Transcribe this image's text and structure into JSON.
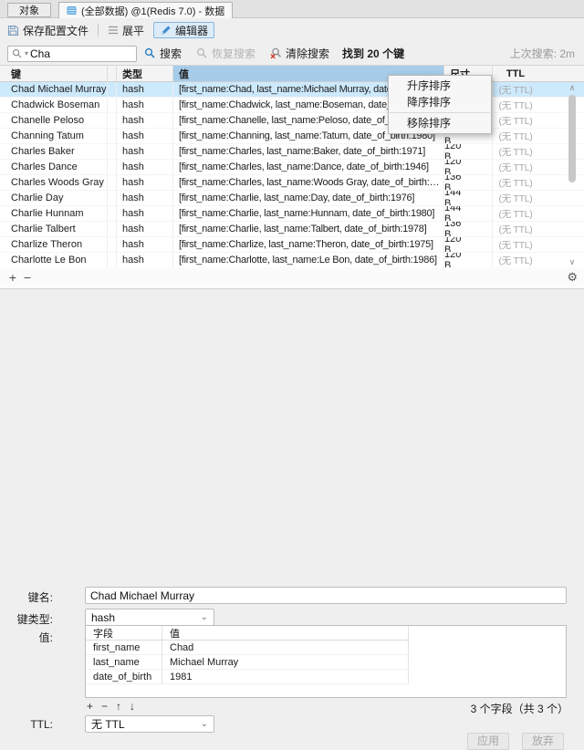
{
  "colors": {
    "accent": "#2e7fc2",
    "selection": "#cde9fc",
    "hdr-hi": "#a6cce9",
    "danger": "#d03b2f",
    "disabled": "#a6a6a6"
  },
  "glyphs": {
    "plus": "+",
    "minus": "−",
    "arrow_up": "↑",
    "arrow_down": "↓",
    "gear": "⚙",
    "chevron_down": "⌄",
    "scroll_up": "∧",
    "scroll_down": "∨"
  },
  "tabs": {
    "objects": "对象",
    "data": "(全部数据) @1(Redis 7.0) - 数据"
  },
  "toolbar": {
    "save": "保存配置文件",
    "flatten": "展平",
    "editor": "编辑器"
  },
  "search": {
    "query": "Cha",
    "search": "搜索",
    "restore": "恢复搜索",
    "clear": "清除搜索",
    "found": "找到 20 个键",
    "last": "上次搜索: 2m"
  },
  "table": {
    "headers": {
      "key": "键",
      "type": "类型",
      "value": "值",
      "size": "尺寸",
      "ttl": "TTL"
    },
    "rows": [
      {
        "key": "Chad Michael Murray",
        "type": "hash",
        "value": "[first_name:Chad, last_name:Michael Murray, date_o",
        "size": "",
        "ttl": "(无 TTL)",
        "selected": true
      },
      {
        "key": "Chadwick Boseman",
        "type": "hash",
        "value": "[first_name:Chadwick, last_name:Boseman, date_of_",
        "size": "",
        "ttl": "(无 TTL)",
        "selected": false
      },
      {
        "key": "Chanelle Peloso",
        "type": "hash",
        "value": "[first_name:Chanelle, last_name:Peloso, date_of_birt",
        "size": "",
        "ttl": "(无 TTL)",
        "selected": false
      },
      {
        "key": "Channing Tatum",
        "type": "hash",
        "value": "[first_name:Channing, last_name:Tatum, date_of_birth:1980]",
        "size": "120 B",
        "ttl": "(无 TTL)",
        "selected": false
      },
      {
        "key": "Charles Baker",
        "type": "hash",
        "value": "[first_name:Charles, last_name:Baker, date_of_birth:1971]",
        "size": "120 B",
        "ttl": "(无 TTL)",
        "selected": false
      },
      {
        "key": "Charles Dance",
        "type": "hash",
        "value": "[first_name:Charles, last_name:Dance, date_of_birth:1946]",
        "size": "120 B",
        "ttl": "(无 TTL)",
        "selected": false
      },
      {
        "key": "Charles Woods Gray",
        "type": "hash",
        "value": "[first_name:Charles, last_name:Woods Gray, date_of_birth:…",
        "size": "136 B",
        "ttl": "(无 TTL)",
        "selected": false
      },
      {
        "key": "Charlie Day",
        "type": "hash",
        "value": "[first_name:Charlie, last_name:Day, date_of_birth:1976]",
        "size": "144 B",
        "ttl": "(无 TTL)",
        "selected": false
      },
      {
        "key": "Charlie Hunnam",
        "type": "hash",
        "value": "[first_name:Charlie, last_name:Hunnam, date_of_birth:1980]",
        "size": "144 B",
        "ttl": "(无 TTL)",
        "selected": false
      },
      {
        "key": "Charlie Talbert",
        "type": "hash",
        "value": "[first_name:Charlie, last_name:Talbert, date_of_birth:1978]",
        "size": "136 B",
        "ttl": "(无 TTL)",
        "selected": false
      },
      {
        "key": "Charlize Theron",
        "type": "hash",
        "value": "[first_name:Charlize, last_name:Theron, date_of_birth:1975]",
        "size": "120 B",
        "ttl": "(无 TTL)",
        "selected": false
      },
      {
        "key": "Charlotte Le Bon",
        "type": "hash",
        "value": "[first_name:Charlotte, last_name:Le Bon, date_of_birth:1986]",
        "size": "120 B",
        "ttl": "(无 TTL)",
        "selected": false
      }
    ]
  },
  "menu": {
    "items": [
      "升序排序",
      "降序排序",
      "移除排序"
    ]
  },
  "editor": {
    "key_label": "键名:",
    "key_value": "Chad Michael Murray",
    "type_label": "键类型:",
    "type_value": "hash",
    "value_label": "值:",
    "fields": {
      "headers": [
        "字段",
        "值"
      ],
      "rows": [
        {
          "field": "first_name",
          "value": "Chad"
        },
        {
          "field": "last_name",
          "value": "Michael Murray"
        },
        {
          "field": "date_of_birth",
          "value": "1981"
        }
      ]
    },
    "count": "3 个字段（共 3 个）",
    "ttl_label": "TTL:",
    "ttl_value": "无 TTL",
    "apply": "应用",
    "discard": "放弃"
  }
}
